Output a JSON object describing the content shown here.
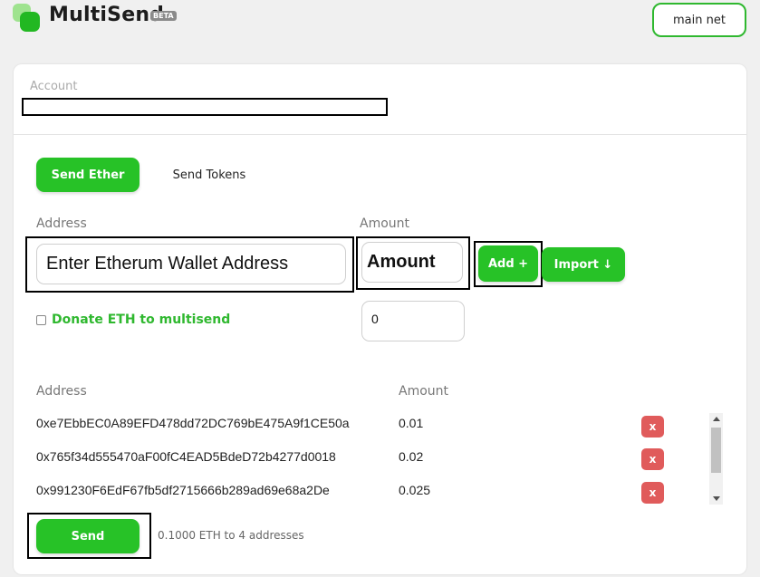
{
  "header": {
    "brand": "MultiSend",
    "badge": "BETA",
    "network_button": "main net"
  },
  "account": {
    "label": "Account",
    "value": ""
  },
  "tabs": [
    {
      "label": "Send Ether",
      "active": true
    },
    {
      "label": "Send Tokens",
      "active": false
    }
  ],
  "form": {
    "address_label": "Address",
    "amount_label": "Amount",
    "address_value": "Enter Etherum Wallet Address",
    "amount_value": "Amount",
    "add_button": "Add +",
    "import_button": "Import ↓",
    "donate_label": "Donate ETH to multisend",
    "donate_checked": false,
    "donate_amount": "0"
  },
  "list": {
    "address_header": "Address",
    "amount_header": "Amount",
    "remove_label": "x",
    "rows": [
      {
        "address": "0xe7EbbEC0A89EFD478dd72DC769bE475A9f1CE50a",
        "amount": "0.01"
      },
      {
        "address": "0x765f34d555470aF00fC4EAD5BdeD72b4277d0018",
        "amount": "0.02"
      },
      {
        "address": "0x991230F6EdF67fb5df2715666b289ad69e68a2De",
        "amount": "0.025"
      }
    ]
  },
  "footer": {
    "send_button": "Send",
    "summary": "0.1000 ETH to 4 addresses"
  },
  "colors": {
    "accent": "#27c227",
    "remove": "#e05b5b",
    "donate_text": "#2fb82f"
  }
}
